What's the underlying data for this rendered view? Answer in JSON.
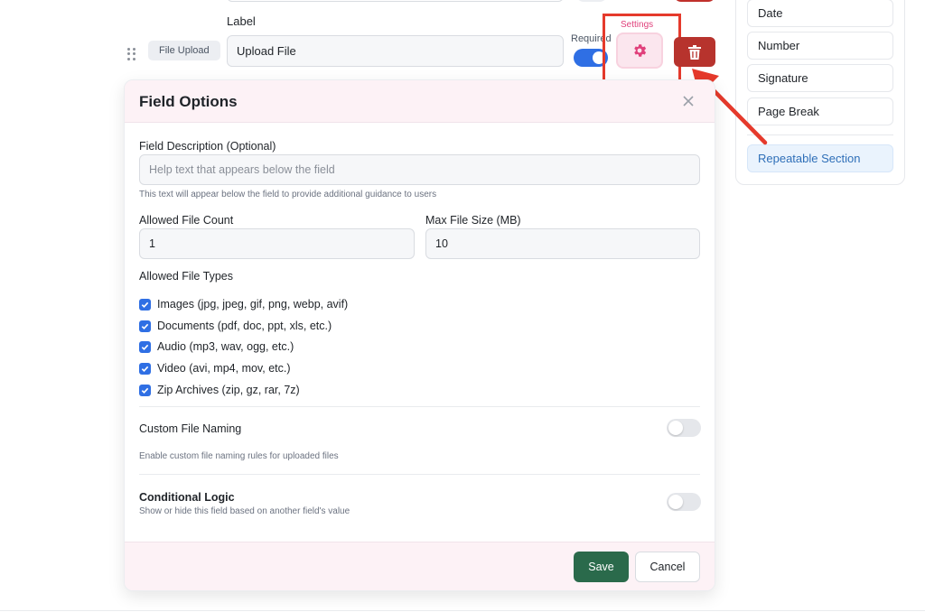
{
  "field_row": {
    "label_caption": "Label",
    "type_chip": "File Upload",
    "label_value": "Upload File",
    "required_label": "Required",
    "required_on": true,
    "settings_caption": "Settings"
  },
  "palette": {
    "items": [
      "Date",
      "Number",
      "Signature",
      "Page Break"
    ],
    "active_item": "Repeatable Section"
  },
  "modal": {
    "title": "Field Options",
    "description": {
      "label": "Field Description (Optional)",
      "placeholder": "Help text that appears below the field",
      "value": "",
      "hint": "This text will appear below the field to provide additional guidance to users"
    },
    "file_count": {
      "label": "Allowed File Count",
      "value": "1"
    },
    "max_size": {
      "label": "Max File Size (MB)",
      "value": "10"
    },
    "file_types": {
      "label": "Allowed File Types",
      "options": [
        {
          "label": "Images (jpg, jpeg, gif, png, webp, avif)",
          "checked": true
        },
        {
          "label": "Documents (pdf, doc, ppt, xls, etc.)",
          "checked": true
        },
        {
          "label": "Audio (mp3, wav, ogg, etc.)",
          "checked": true
        },
        {
          "label": "Video (avi, mp4, mov, etc.)",
          "checked": true
        },
        {
          "label": "Zip Archives (zip, gz, rar, 7z)",
          "checked": true
        }
      ]
    },
    "custom_naming": {
      "label": "Custom File Naming",
      "hint": "Enable custom file naming rules for uploaded files",
      "enabled": false
    },
    "conditional_logic": {
      "label": "Conditional Logic",
      "hint": "Show or hide this field based on another field's value",
      "enabled": false
    },
    "save_label": "Save",
    "cancel_label": "Cancel"
  },
  "colors": {
    "accent_pink": "#e0407b",
    "delete_red": "#b7332d",
    "toggle_blue": "#2f6fe4",
    "save_green": "#2a6a4b",
    "annotation_red": "#e53a2c"
  },
  "icons": {
    "settings": "gear-icon",
    "delete": "trash-icon",
    "close": "close-icon",
    "drag": "drag-handle-icon",
    "annotation": "arrow-icon"
  }
}
